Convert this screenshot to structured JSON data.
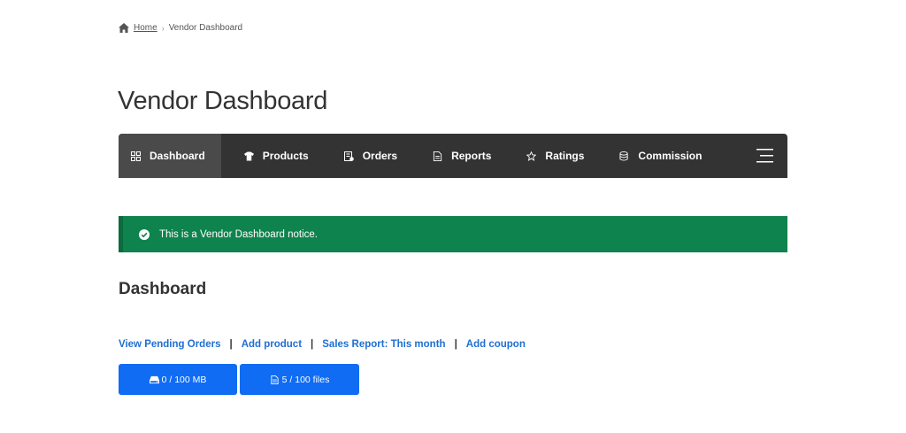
{
  "breadcrumb": {
    "home": "Home",
    "separator": "›",
    "current": "Vendor Dashboard",
    "icon": "home-icon"
  },
  "page_title": "Vendor Dashboard",
  "nav": {
    "items": [
      {
        "label": "Dashboard",
        "icon": "grid-icon",
        "active": true
      },
      {
        "label": "Products",
        "icon": "shirt-icon"
      },
      {
        "label": "Orders",
        "icon": "orders-icon"
      },
      {
        "label": "Reports",
        "icon": "file-icon"
      },
      {
        "label": "Ratings",
        "icon": "star-icon"
      },
      {
        "label": "Commission",
        "icon": "coins-icon"
      }
    ],
    "menu_icon": "hamburger-icon"
  },
  "notice": {
    "text": "This is a Vendor Dashboard notice.",
    "icon": "check-circle-icon",
    "color": "#0f834d"
  },
  "section_title": "Dashboard",
  "quick_links": [
    {
      "label": "View Pending Orders"
    },
    {
      "label": "Add product"
    },
    {
      "label": "Sales Report: This month"
    },
    {
      "label": "Add coupon"
    }
  ],
  "link_separator": "|",
  "quotas": {
    "storage": {
      "label": "0 / 100 MB",
      "icon": "hdd-icon"
    },
    "files": {
      "label": "5 / 100 files",
      "icon": "file-icon"
    }
  },
  "colors": {
    "nav_bg": "#333333",
    "accent": "#0f6cf3",
    "link": "#1f6fd1"
  }
}
